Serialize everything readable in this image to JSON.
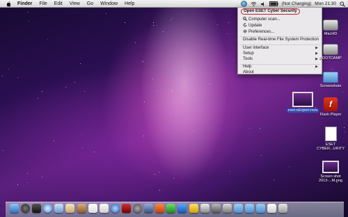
{
  "menubar": {
    "items": [
      {
        "label": "Finder",
        "bold": true
      },
      {
        "label": "File"
      },
      {
        "label": "Edit"
      },
      {
        "label": "View"
      },
      {
        "label": "Go"
      },
      {
        "label": "Window"
      },
      {
        "label": "Help"
      }
    ],
    "battery_text": "(Not Charging)",
    "clock": "Mon 21:30"
  },
  "eset_menu": {
    "items": [
      {
        "label": "Open ESET Cyber Security",
        "highlighted": true
      },
      {
        "label": "Computer scan...",
        "icon": "magnifier-icon"
      },
      {
        "label": "Update",
        "icon": "refresh-icon"
      },
      {
        "label": "Preferences...",
        "icon": "gear-icon"
      },
      {
        "label": "Disable Real-time File System Protection"
      },
      {
        "label": "User interface",
        "submenu": true
      },
      {
        "label": "Setup",
        "submenu": true
      },
      {
        "label": "Tools",
        "submenu": true
      },
      {
        "label": "Help",
        "submenu": true
      },
      {
        "label": "About"
      }
    ]
  },
  "desktop_icons": [
    {
      "label": "MacHD",
      "type": "hard-drive"
    },
    {
      "label": "BOOTCAMP",
      "type": "hard-drive"
    },
    {
      "label": "Screenshots",
      "type": "folder"
    },
    {
      "label": "Flash Player",
      "type": "flash"
    },
    {
      "label": "ESET CYBER...URITY",
      "type": "document"
    },
    {
      "label": "Screen shot 2013-...M.png",
      "type": "screenshot"
    },
    {
      "label": "eset eExpert.mov",
      "type": "movie",
      "selected": true
    }
  ],
  "dock": {
    "items": [
      "finder",
      "dashboard",
      "mission-control",
      "safari",
      "mail",
      "preview",
      "contacts",
      "calendar",
      "reminders",
      "itunes",
      "photobooth",
      "system-preferences",
      "app-1",
      "app-2",
      "app-3",
      "app-4",
      "app-5",
      "app-6",
      "app-7",
      "app-8",
      "downloads",
      "documents",
      "applications",
      "document",
      "trash"
    ]
  },
  "colors": {
    "menu_highlight_border": "#c0222d",
    "selection": "#2a5bd7"
  }
}
